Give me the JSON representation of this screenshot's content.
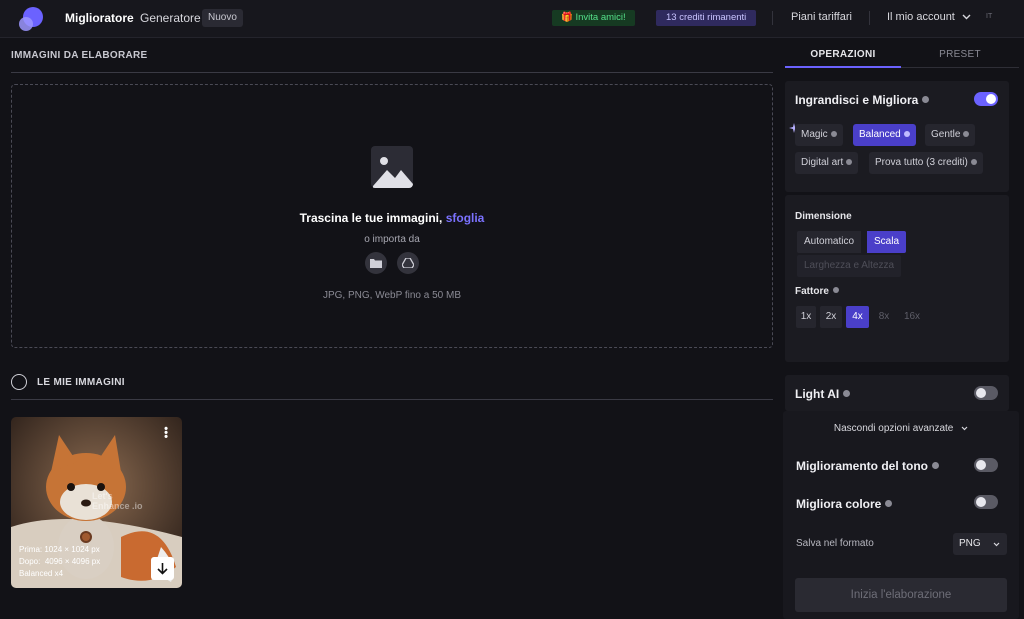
{
  "header": {
    "nav_active": "Miglioratore",
    "nav_generator": "Generatore",
    "badge_new": "Nuovo",
    "invite": "Invita amici!",
    "credits": "13 crediti rimanenti",
    "plans": "Piani tariffari",
    "account": "Il mio account",
    "lang": "IT"
  },
  "upload": {
    "section_title": "IMMAGINI DA ELABORARE",
    "drop_text": "Trascina le tue immagini,",
    "browse_link": "sfoglia",
    "import_text": "o importa da",
    "formats": "JPG, PNG, WebP fino a 50 MB"
  },
  "my_images": {
    "title": "LE MIE IMMAGINI",
    "items": [
      {
        "watermark": "Let's Enhance .io",
        "before_label": "Prima:",
        "before_value": "1024 × 1024 px",
        "after_label": "Dopo:",
        "after_value": "4096 × 4096 px",
        "preset": "Balanced x4"
      }
    ]
  },
  "tabs": {
    "operations": "OPERAZIONI",
    "preset": "PRESET"
  },
  "upscale": {
    "title": "Ingrandisci e Migliora",
    "enabled": true,
    "modes": [
      {
        "label": "Magic",
        "selected": false
      },
      {
        "label": "Balanced",
        "selected": true
      },
      {
        "label": "Gentle",
        "selected": false
      },
      {
        "label": "Digital art",
        "selected": false
      },
      {
        "label": "Prova tutto (3 crediti)",
        "selected": false
      }
    ],
    "dimension_label": "Dimensione",
    "dimension_auto": "Automatico",
    "dimension_scale": "Scala",
    "dimension_wh": "Larghezza e Altezza",
    "factor_label": "Fattore",
    "factors": [
      "1x",
      "2x",
      "4x",
      "8x",
      "16x"
    ],
    "factor_selected": "4x"
  },
  "light_ai": {
    "title": "Light AI",
    "enabled": false
  },
  "advanced": {
    "toggle_label": "Nascondi opzioni avanzate",
    "tone": {
      "label": "Miglioramento del tono",
      "enabled": false
    },
    "color": {
      "label": "Migliora colore",
      "enabled": false
    },
    "format_label": "Salva nel formato",
    "format_value": "PNG"
  },
  "start_button": "Inizia l'elaborazione",
  "colors": {
    "accent": "#6b62ff",
    "selected": "#4a3fc9",
    "background": "#121217",
    "panel": "#1b1b21"
  }
}
